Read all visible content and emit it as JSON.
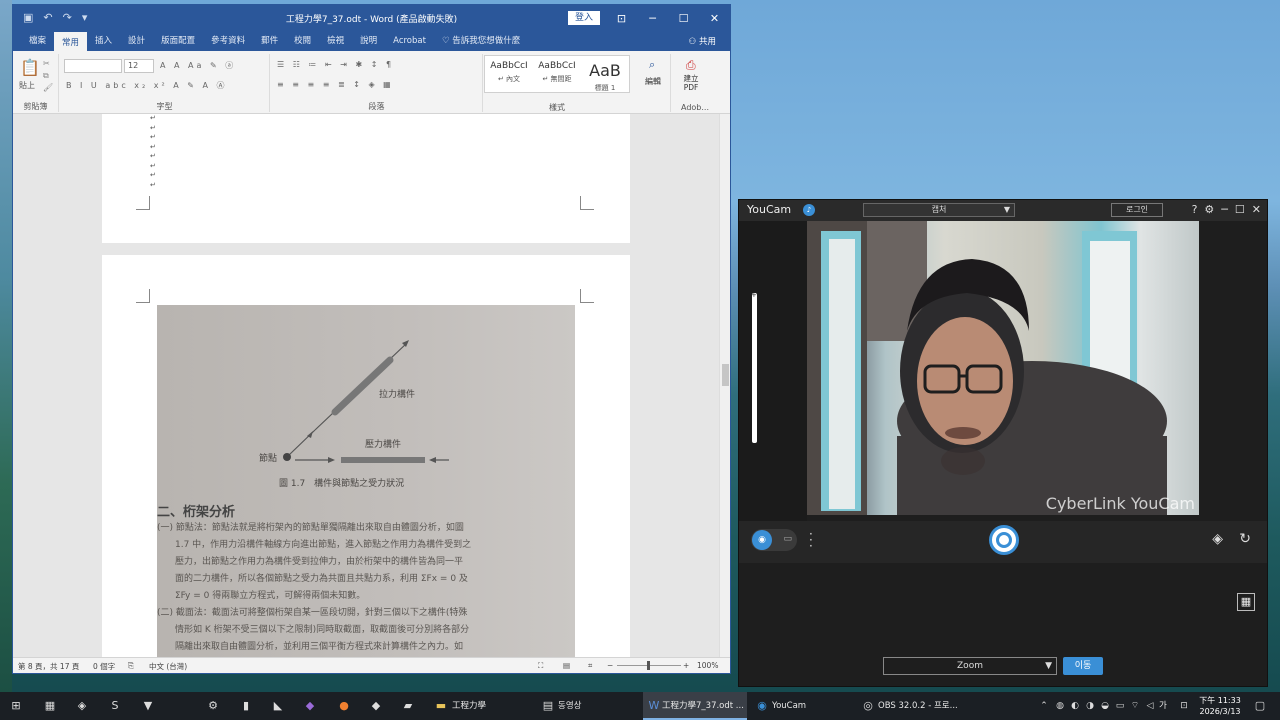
{
  "word": {
    "title": "工程力學7_37.odt - Word (產品啟動失敗)",
    "login": "登入",
    "share": "共用",
    "tabs": [
      "檔案",
      "常用",
      "插入",
      "設計",
      "版面配置",
      "參考資料",
      "郵件",
      "校閱",
      "檢視",
      "說明",
      "Acrobat",
      "告訴我您想做什麼"
    ],
    "active_tab": "常用",
    "ribbon_groups": {
      "clipboard": "剪貼簿",
      "paste": "貼上",
      "font": "字型",
      "paragraph": "段落",
      "styles": "樣式",
      "editing": "編輯",
      "create_pdf": "建立 PDF",
      "adobe": "Adob..."
    },
    "font_size": "12",
    "styles": [
      {
        "sample": "AaBbCcI",
        "name": "↵ 內文"
      },
      {
        "sample": "AaBbCcI",
        "name": "↵ 無間距"
      },
      {
        "sample": "AaB",
        "name": "標題 1"
      }
    ],
    "figure": {
      "label_tension": "拉力構件",
      "label_compression": "壓力構件",
      "label_node": "節點",
      "caption": "圖 1.7　構件與節點之受力狀況"
    },
    "section_heading": "二、桁架分析",
    "paragraphs": [
      "(一) 節點法：節點法就是將桁架內的節點單獨隔離出來取自由體圖分析，如圖",
      "1.7 中，作用力沿構件軸線方向進出節點，進入節點之作用力為構件受到之",
      "壓力，出節點之作用力為構件受到拉伸力，由於桁架中的構件皆為同一平",
      "面的二力構件，所以各個節點之受力為共面且共點力系，利用 ΣFx = 0 及",
      "ΣFy = 0 得兩聯立方程式，可解得兩個未知數。",
      "(二) 截面法：截面法可將整個桁架自某一區段切開，針對三個以下之構件(特殊",
      "情形如 K 桁架不受三個以下之限制)同時取截面，取截面後可分別將各部分",
      "隔離出來取自由體圖分析，並利用三個平衡方程式來計算構件之內力。如"
    ],
    "status": {
      "page": "第 8 頁，共 17 頁",
      "words": "0 個字",
      "lang": "中文 (台灣)",
      "zoom": "100%"
    }
  },
  "youcam": {
    "title": "YouCam",
    "capture_select": "캡처",
    "login": "로그인",
    "watermark": "CyberLink YouCam",
    "effect_select": "Zoom",
    "move_button": "이동"
  },
  "taskbar": {
    "apps": [
      {
        "label": "工程力學"
      },
      {
        "label": "동영상"
      },
      {
        "label": "工程力學7_37.odt ..."
      },
      {
        "label": "YouCam"
      },
      {
        "label": "OBS 32.0.2 - 프로..."
      }
    ],
    "ime": "가",
    "time": "下午 11:33",
    "date": "2026/3/13"
  }
}
